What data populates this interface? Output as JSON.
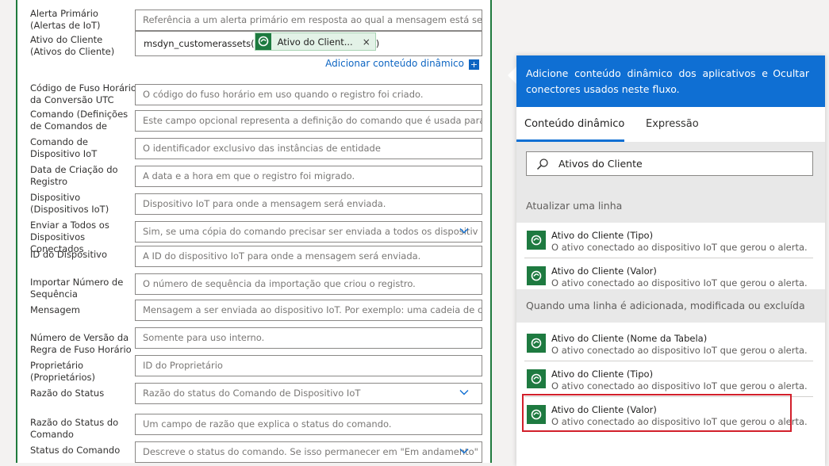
{
  "form": {
    "fields": [
      {
        "label": "Alerta Primário (Alertas de IoT)",
        "placeholder": "Referência a um alerta primário em resposta ao qual a mensagem está sendo e",
        "dropdown": false
      },
      {
        "label": "Ativo do Cliente (Ativos do Cliente)",
        "value_prefix": "msdyn_customerassets(",
        "token": "Ativo do Client...",
        "token_close": "×",
        "value_suffix": ")"
      },
      {
        "label": "Código de Fuso Horário da Conversão UTC",
        "placeholder": "O código do fuso horário em uso quando o registro foi criado.",
        "dropdown": false
      },
      {
        "label": "Comando (Definições de Comandos de Dispositivo IoT)",
        "placeholder": "Este campo opcional representa a definição do comando que é usada para con",
        "dropdown": false
      },
      {
        "label": "Comando de Dispositivo IoT",
        "placeholder": "O identificador exclusivo das instâncias de entidade",
        "dropdown": false
      },
      {
        "label": "Data de Criação do Registro",
        "placeholder": "A data e a hora em que o registro foi migrado.",
        "dropdown": false
      },
      {
        "label": "Dispositivo (Dispositivos IoT)",
        "placeholder": "Dispositivo IoT para onde a mensagem será enviada.",
        "dropdown": false
      },
      {
        "label": "Enviar a Todos os Dispositivos Conectados",
        "placeholder": "Sim, se uma cópia do comando precisar ser enviada a todos os dispositiv",
        "dropdown": true
      },
      {
        "label": "ID do Dispositivo",
        "placeholder": "A ID do dispositivo IoT para onde a mensagem será enviada.",
        "dropdown": false
      },
      {
        "label": "Importar Número de Sequência",
        "placeholder": "O número de sequência da importação que criou o registro.",
        "dropdown": false
      },
      {
        "label": "Mensagem",
        "placeholder": "Mensagem a ser enviada ao dispositivo IoT. Por exemplo: uma cadeia de caract",
        "dropdown": false
      },
      {
        "label": "Número de Versão da Regra de Fuso Horário",
        "placeholder": "Somente para uso interno.",
        "dropdown": false
      },
      {
        "label": "Proprietário (Proprietários)",
        "placeholder": "ID do Proprietário",
        "dropdown": false
      },
      {
        "label": "Razão do Status",
        "placeholder": "Razão do status do Comando de Dispositivo IoT",
        "dropdown": true
      },
      {
        "label": "Razão do Status do Comando",
        "placeholder": "Um campo de razão que explica o status do comando.",
        "dropdown": false
      },
      {
        "label": "Status do Comando",
        "placeholder": "Descreve o status do comando. Se isso permanecer em \"Em andamento\"",
        "dropdown": true
      }
    ],
    "dynamic_link": "Adicionar conteúdo dinâmico",
    "dynamic_link_plus": "+"
  },
  "panel": {
    "header_text": "Adicione conteúdo dinâmico dos aplicativos e conectores usados neste fluxo.",
    "hide_label": "Ocultar",
    "tabs": [
      {
        "label": "Conteúdo dinâmico",
        "active": true
      },
      {
        "label": "Expressão",
        "active": false
      }
    ],
    "search_value": "Ativos do Cliente",
    "sections": [
      {
        "title": "Atualizar uma linha",
        "items": [
          {
            "title": "Ativo do Cliente (Tipo)",
            "desc": "O ativo conectado ao dispositivo IoT que gerou o alerta."
          },
          {
            "title": "Ativo do Cliente (Valor)",
            "desc": "O ativo conectado ao dispositivo IoT que gerou o alerta."
          }
        ]
      },
      {
        "title": "Quando uma linha é adicionada, modificada ou excluída",
        "items": [
          {
            "title": "Ativo do Cliente (Nome da Tabela)",
            "desc": "O ativo conectado ao dispositivo IoT que gerou o alerta."
          },
          {
            "title": "Ativo do Cliente (Tipo)",
            "desc": "O ativo conectado ao dispositivo IoT que gerou o alerta."
          },
          {
            "title": "Ativo do Cliente (Valor)",
            "desc": "O ativo conectado ao dispositivo IoT que gerou o alerta."
          }
        ]
      }
    ]
  },
  "colors": {
    "header_blue": "#0f6fd3",
    "dataverse_green": "#1e7a40",
    "highlight_red": "#d21f2b",
    "link_blue": "#0d65c2"
  },
  "icons": {
    "token_icon": "dataverse-icon",
    "item_icon": "dataverse-icon",
    "search_icon": "search-icon",
    "dropdown_icon": "chevron-down-icon"
  }
}
